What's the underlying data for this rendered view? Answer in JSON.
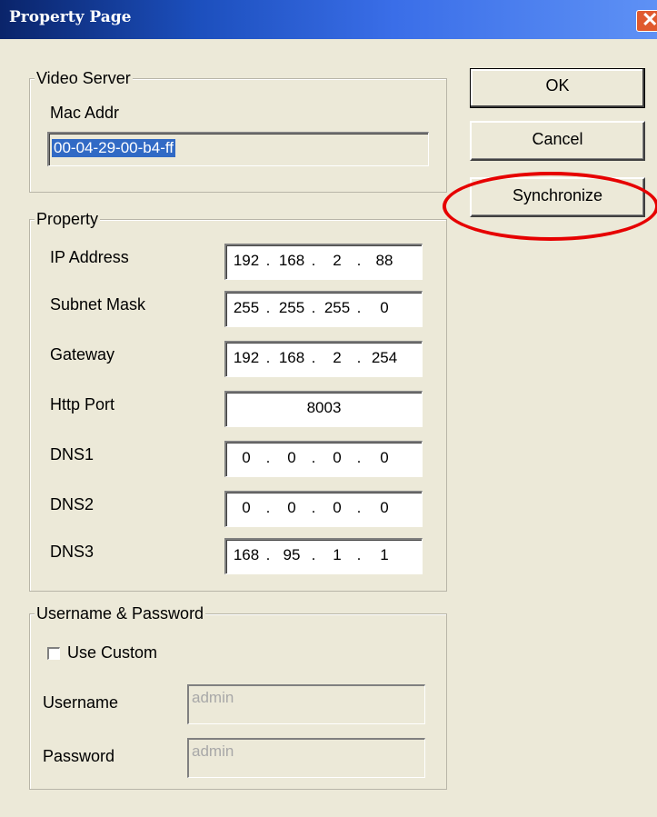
{
  "window": {
    "title": "Property Page",
    "close_glyph": "✕"
  },
  "video_server": {
    "legend": "Video Server",
    "mac_label": "Mac Addr",
    "mac_value": "00-04-29-00-b4-ff"
  },
  "property": {
    "legend": "Property",
    "ip_address": {
      "label": "IP Address",
      "octets": [
        "192",
        "168",
        "2",
        "88"
      ]
    },
    "subnet_mask": {
      "label": "Subnet Mask",
      "octets": [
        "255",
        "255",
        "255",
        "0"
      ]
    },
    "gateway": {
      "label": "Gateway",
      "octets": [
        "192",
        "168",
        "2",
        "254"
      ]
    },
    "http_port": {
      "label": "Http Port",
      "value": "8003"
    },
    "dns1": {
      "label": "DNS1",
      "octets": [
        "0",
        "0",
        "0",
        "0"
      ]
    },
    "dns2": {
      "label": "DNS2",
      "octets": [
        "0",
        "0",
        "0",
        "0"
      ]
    },
    "dns3": {
      "label": "DNS3",
      "octets": [
        "168",
        "95",
        "1",
        "1"
      ]
    }
  },
  "credentials": {
    "legend": "Username & Password",
    "use_custom_label": "Use Custom",
    "use_custom_checked": false,
    "username_label": "Username",
    "username_value": "admin",
    "password_label": "Password",
    "password_value": "admin"
  },
  "buttons": {
    "ok": "OK",
    "cancel": "Cancel",
    "synchronize": "Synchronize"
  },
  "colors": {
    "title_bar": "#0a246a",
    "highlight": "#e60000",
    "face": "#ece9d8"
  }
}
